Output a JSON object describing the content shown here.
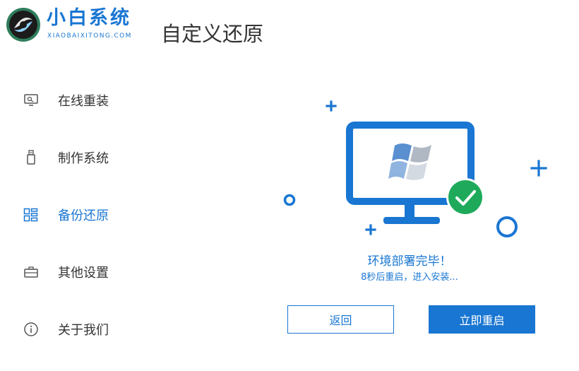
{
  "brand": {
    "name": "小白系统",
    "subtitle": "XIAOBAIXITONG.COM",
    "accent_color": "#1976d2"
  },
  "page_title": "自定义还原",
  "sidebar": {
    "items": [
      {
        "label": "在线重装",
        "icon": "monitor-icon",
        "active": false
      },
      {
        "label": "制作系统",
        "icon": "usb-icon",
        "active": false
      },
      {
        "label": "备份还原",
        "icon": "backup-grid-icon",
        "active": true
      },
      {
        "label": "其他设置",
        "icon": "briefcase-icon",
        "active": false
      },
      {
        "label": "关于我们",
        "icon": "info-icon",
        "active": false
      }
    ]
  },
  "status": {
    "message": "环境部署完毕！",
    "detail": "8秒后重启，进入安装..."
  },
  "buttons": {
    "back_label": "返回",
    "restart_label": "立即重启"
  }
}
